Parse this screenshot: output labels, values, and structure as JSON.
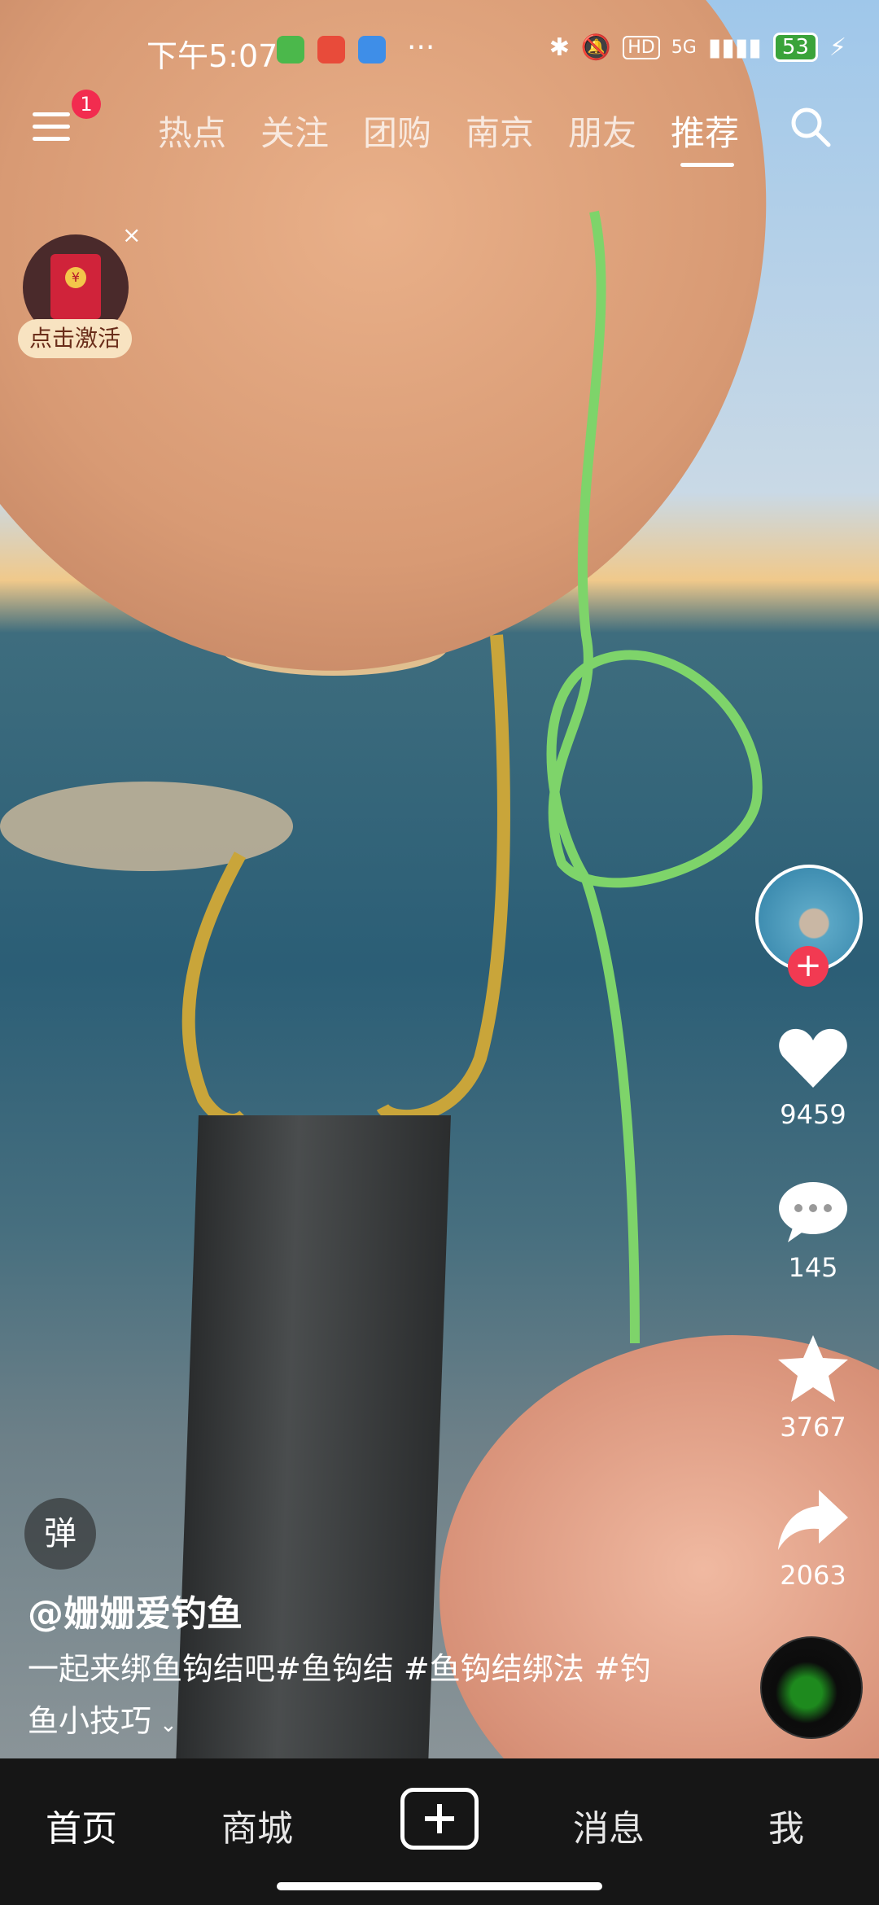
{
  "status_bar": {
    "time": "下午5:07",
    "more": "···",
    "network": "5G",
    "hd": "HD",
    "battery": "53"
  },
  "top_tabs": [
    {
      "label": "热点"
    },
    {
      "label": "关注"
    },
    {
      "label": "团购"
    },
    {
      "label": "南京"
    },
    {
      "label": "朋友"
    },
    {
      "label": "推荐"
    }
  ],
  "menu": {
    "badge": "1"
  },
  "red_packet": {
    "label": "点击激活",
    "close": "×",
    "coin": "¥"
  },
  "actions": {
    "likes": "9459",
    "comments": "145",
    "favorites": "3767",
    "shares": "2063"
  },
  "video_info": {
    "danmu": "弹",
    "author": "@姗姗爱钓鱼",
    "description": "一起来绑鱼钩结吧#鱼钩结 #鱼钩结绑法 #钓鱼小技巧",
    "expand_icon": "⌄"
  },
  "bottom_nav": {
    "home": "首页",
    "mall": "商城",
    "messages": "消息",
    "me": "我"
  },
  "colors": {
    "accent_red": "#f23a52",
    "nav_bg": "#161616"
  }
}
